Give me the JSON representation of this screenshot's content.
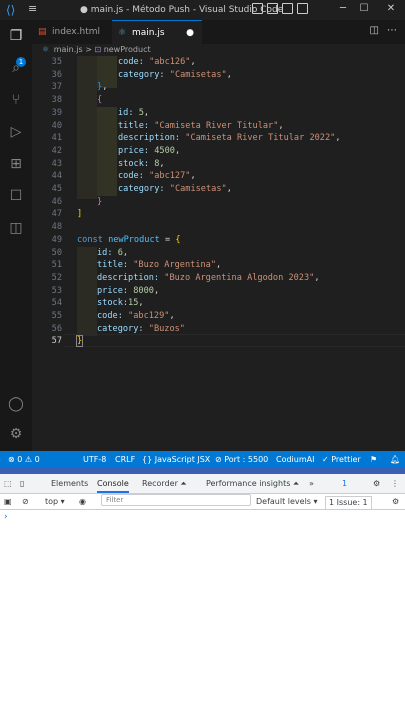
{
  "titlebar": {
    "title": "● main.js - Método Push - Visual Studio Code",
    "minimize": "─",
    "maximize": "☐",
    "close": "✕"
  },
  "activity": {
    "explorer_badge": "1"
  },
  "tabs": [
    {
      "label": "index.html",
      "icon": "html-file-icon",
      "active": false
    },
    {
      "label": "main.js",
      "icon": "js-file-icon",
      "active": true,
      "modified": "●"
    }
  ],
  "breadcrumb": {
    "file": "main.js",
    "separator": ">",
    "symbol": "newProduct"
  },
  "editor": {
    "lines": [
      {
        "num": "35"
      },
      {
        "num": "36"
      },
      {
        "num": "37"
      },
      {
        "num": "38"
      },
      {
        "num": "39"
      },
      {
        "num": "40"
      },
      {
        "num": "41"
      },
      {
        "num": "42"
      },
      {
        "num": "43"
      },
      {
        "num": "44"
      },
      {
        "num": "45"
      },
      {
        "num": "46"
      },
      {
        "num": "47"
      },
      {
        "num": "48"
      },
      {
        "num": "49"
      },
      {
        "num": "50"
      },
      {
        "num": "51"
      },
      {
        "num": "52"
      },
      {
        "num": "53"
      },
      {
        "num": "54"
      },
      {
        "num": "55"
      },
      {
        "num": "56"
      },
      {
        "num": "57"
      }
    ],
    "code": {
      "l35_key": "code:",
      "l35_val": "\"abc126\"",
      "l35_end": ",",
      "l36_key": "category:",
      "l36_val": "\"Camisetas\"",
      "l36_end": ",",
      "l37_brace": "}",
      "l37_end": ",",
      "l38_brace": "{",
      "l39_key": "id:",
      "l39_val": "5",
      "l39_end": ",",
      "l40_key": "title:",
      "l40_val": "\"Camiseta River Titular\"",
      "l40_end": ",",
      "l41_key": "description:",
      "l41_val": "\"Camiseta River Titular 2022\"",
      "l41_end": ",",
      "l42_key": "price:",
      "l42_val": "4500",
      "l42_end": ",",
      "l43_key": "stock:",
      "l43_val": "8",
      "l43_end": ",",
      "l44_key": "code:",
      "l44_val": "\"abc127\"",
      "l44_end": ",",
      "l45_key": "category:",
      "l45_val": "\"Camisetas\"",
      "l45_end": ",",
      "l46_brace": "}",
      "l47_bracket": "]",
      "l49_kw": "const",
      "l49_name": "newProduct",
      "l49_op": "=",
      "l49_brace": "{",
      "l50_key": "id:",
      "l50_val": "6",
      "l50_end": ",",
      "l51_key": "title:",
      "l51_val": "\"Buzo Argentina\"",
      "l51_end": ",",
      "l52_key": "description:",
      "l52_val": "\"Buzo Argentina Algodon 2023\"",
      "l52_end": ",",
      "l53_key": "price:",
      "l53_val": "8000",
      "l53_end": ",",
      "l54_key": "stock:",
      "l54_val": "15",
      "l54_end": ",",
      "l55_key": "code:",
      "l55_val": "\"abc129\"",
      "l55_end": ",",
      "l56_key": "category:",
      "l56_val": "\"Buzos\"",
      "l57_brace": "}"
    }
  },
  "statusbar": {
    "problems": "⊗ 0 ⚠ 0",
    "encoding": "UTF-8",
    "eol": "CRLF",
    "language": "{} JavaScript JSX",
    "port": "⊘ Port : 5500",
    "codium": "CodiumAI",
    "prettier": "✓ Prettier"
  },
  "devtools": {
    "tabs": [
      "Elements",
      "Console",
      "Recorder ⏶",
      "Performance insights ⏶"
    ],
    "more": "»",
    "issues_count": "1",
    "context": "top ▾",
    "filter_placeholder": "Filter",
    "levels": "Default levels ▾",
    "issues_label": "1 Issue: 1",
    "prompt": "›"
  },
  "colors": {
    "accent": "#0078d4",
    "editor_bg": "#1f1f1f",
    "statusbar": "#0078d4"
  }
}
